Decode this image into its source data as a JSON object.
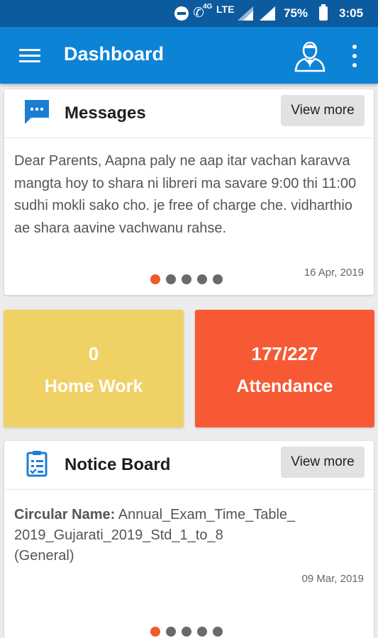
{
  "status_bar": {
    "network_4g": "4G",
    "network_type": "LTE",
    "battery": "75%",
    "time": "3:05",
    "icons": [
      "dnd-icon",
      "wifi-call-icon",
      "signal-icon",
      "signal-icon",
      "battery-icon"
    ]
  },
  "app_bar": {
    "title": "Dashboard",
    "icons": [
      "menu-icon",
      "profile-icon",
      "more-vert-icon"
    ],
    "background": "#0d83d6"
  },
  "messages": {
    "title": "Messages",
    "view_more": "View more",
    "text": "Dear Parents, Aapna paly ne aap itar vachan karavva mangta hoy to shara ni libreri ma savare 9:00 thi 11:00 sudhi mokli sako cho. je free of charge che. vidharthio ae shara aavine vachwanu rahse.",
    "date": "16 Apr, 2019",
    "pager": {
      "total": 5,
      "active": 1
    }
  },
  "tiles": {
    "homework": {
      "value": "0",
      "label": "Home Work",
      "color": "#f0d165"
    },
    "attendance": {
      "value": "177/227",
      "label": "Attendance",
      "color": "#f75934"
    }
  },
  "notice_board": {
    "title": "Notice Board",
    "view_more": "View more",
    "circular_label": "Circular Name:",
    "circular_name": "Annual_Exam_Time_Table_ 2019_Gujarati_2019_Std_1_to_8",
    "category": "(General)",
    "date": "09 Mar, 2019",
    "pager": {
      "total": 5,
      "active": 1
    }
  },
  "colors": {
    "status_bar": "#0c5b9f",
    "accent_dot": "#f05a28",
    "icon_blue": "#1a7fd4"
  }
}
